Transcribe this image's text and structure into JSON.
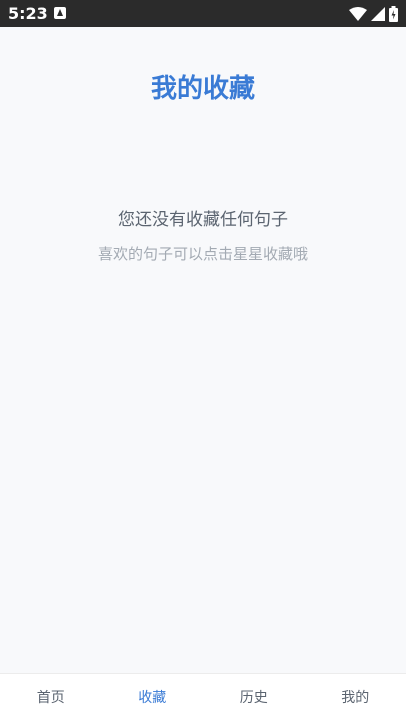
{
  "status_bar": {
    "time": "5:23"
  },
  "header": {
    "title": "我的收藏"
  },
  "empty_state": {
    "title": "您还没有收藏任何句子",
    "hint": "喜欢的句子可以点击星星收藏哦"
  },
  "tab_bar": {
    "active": "收藏",
    "items": [
      {
        "label": "首页"
      },
      {
        "label": "收藏"
      },
      {
        "label": "历史"
      },
      {
        "label": "我的"
      }
    ]
  },
  "colors": {
    "accent": "#3a7bd5",
    "background": "#f8f9fb",
    "status_bar": "#2b2b2b",
    "text_primary": "#5b6470",
    "text_secondary": "#a3aab3"
  },
  "icons": [
    "app-notification-icon",
    "wifi-icon",
    "signal-icon",
    "battery-icon"
  ]
}
